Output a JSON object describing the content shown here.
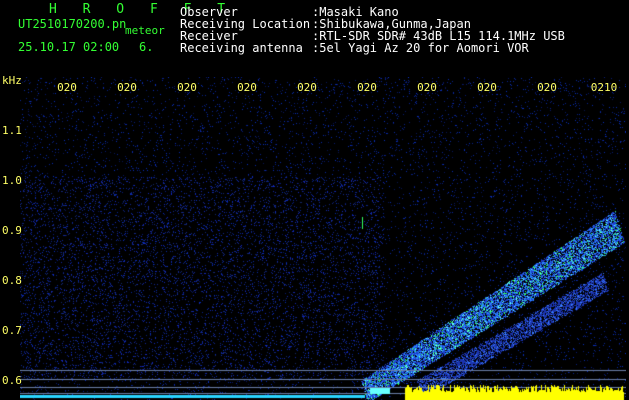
{
  "logo": "H R O F F T",
  "file": {
    "name": "UT2510170200.pn",
    "type": "meteor",
    "datetime": "25.10.17 02:00",
    "count": "6."
  },
  "info": [
    {
      "label": "Observer",
      "value": ":Masaki Kano"
    },
    {
      "label": "Receiving Location",
      "value": ":Shibukawa,Gunma,Japan"
    },
    {
      "label": "Receiver",
      "value": ":RTL-SDR SDR# 43dB L15 114.1MHz USB"
    },
    {
      "label": "Receiving antenna",
      "value": ":5el Yagi Az 20 for Aomori VOR"
    }
  ],
  "axis": {
    "y_unit": "kHz",
    "y_ticks": [
      "1.1",
      "1.0",
      "0.9",
      "0.8",
      "0.7",
      "0.6"
    ],
    "x_ticks": [
      "020",
      "020",
      "020",
      "020",
      "020",
      "020",
      "020",
      "020",
      "020",
      "0210"
    ]
  },
  "colors": {
    "background": "#000000",
    "noise": "#1a2aa8",
    "signal": "#33ff66",
    "baseline": "#ffff00",
    "text_green": "#33ff33",
    "text_white": "#ffffff",
    "tick_yellow": "#ffff66"
  }
}
